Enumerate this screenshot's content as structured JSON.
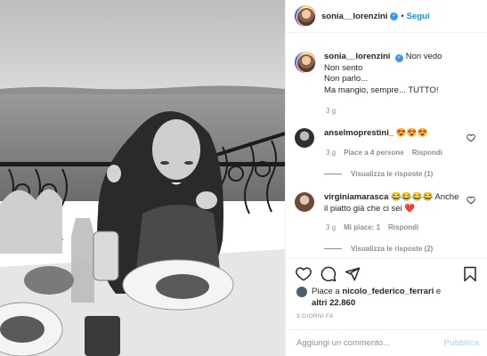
{
  "header": {
    "username": "sonia__lorenzini",
    "follow_label": "Segui",
    "separator": "•"
  },
  "caption": {
    "username": "sonia__lorenzini",
    "lines": [
      "Non vedo",
      "Non sento",
      "Non parlo...",
      "Ma mangio, sempre... TUTTO!"
    ],
    "age": "3 g"
  },
  "comments": [
    {
      "username": "anselmoprestini_",
      "text": "😍😍😍",
      "age": "3 g",
      "likes": "Piace a 4 persone",
      "reply": "Rispondi",
      "view_replies": "Visualizza le risposte (1)"
    },
    {
      "username": "virginiamarasca",
      "text": "😂😂😂😂 Anche",
      "text2": "il piatto già che ci sei ❤️",
      "age": "3 g",
      "likes": "Mi piace: 1",
      "reply": "Rispondi",
      "view_replies": "Visualizza le risposte (2)"
    }
  ],
  "likes": {
    "prefix": "Piace a ",
    "user": "nicolo_federico_ferrari",
    "suffix": " e",
    "line2_prefix": "altri ",
    "count": "22.860"
  },
  "posted": "3 GIORNI FA",
  "comment_box": {
    "placeholder": "Aggiungi un commento...",
    "publish": "Pubblica"
  },
  "colors": {
    "accent": "#0095f6",
    "verified": "#3897f0",
    "meta": "#8e8e8e",
    "publish_disabled": "#b2dffc"
  },
  "icons": [
    "heart-icon",
    "comment-icon",
    "share-icon",
    "bookmark-icon",
    "verified-icon"
  ]
}
